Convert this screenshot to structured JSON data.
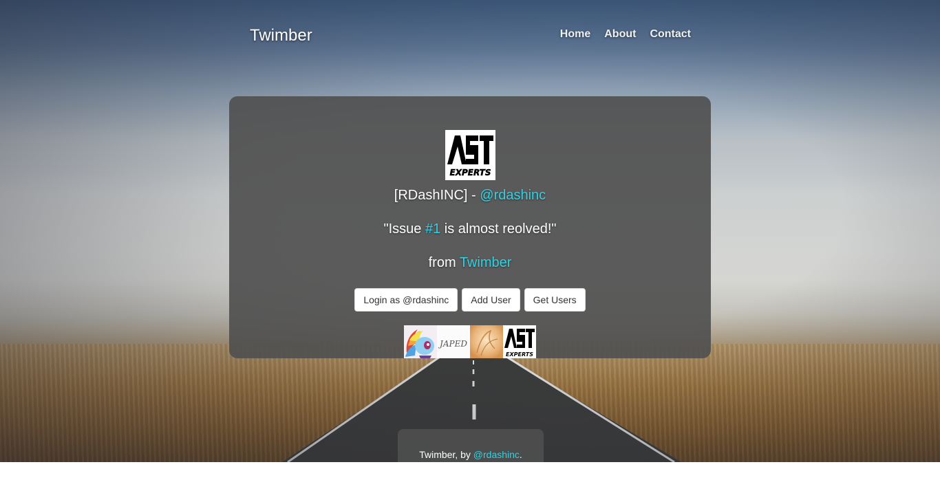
{
  "nav": {
    "brand": "Twimber",
    "links": [
      "Home",
      "About",
      "Contact"
    ]
  },
  "card": {
    "avatar_logo_text": [
      "AST",
      "EXPERTS"
    ],
    "name": "[RDashINC]",
    "separator": " - ",
    "handle": "@rdashinc",
    "quote_open": "\"Issue ",
    "issue_link": "#1",
    "quote_close": " is almost reolved!\"",
    "from_label": "from ",
    "from_link": "Twimber",
    "buttons": {
      "login": "Login as @rdashinc",
      "add_user": "Add User",
      "get_users": "Get Users"
    },
    "thumb_signature": "JAPED"
  },
  "footer": {
    "text": "Twimber, by ",
    "link": "@rdashinc",
    "suffix": "."
  },
  "colors": {
    "accent": "#2fd3e6",
    "card_bg": "#505050"
  }
}
